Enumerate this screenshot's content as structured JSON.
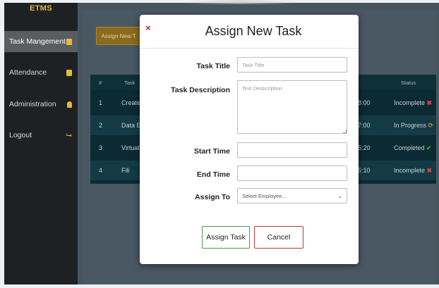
{
  "app": {
    "brand": "ETMS"
  },
  "sidebar": {
    "items": [
      {
        "label": "Task Mangement",
        "icon": "list-icon",
        "active": true
      },
      {
        "label": "Attendance",
        "icon": "list-icon",
        "active": false
      },
      {
        "label": "Administration",
        "icon": "user-icon",
        "active": false
      },
      {
        "label": "Logout",
        "icon": "logout-icon",
        "active": false
      }
    ]
  },
  "main": {
    "assign_button_label": "Assign New T",
    "table": {
      "headers": [
        "#",
        "Task",
        "",
        "Status"
      ],
      "rows": [
        {
          "num": "1",
          "task": "Create",
          "time": "18:00",
          "status": "Incomplete",
          "status_icon": "x-icon"
        },
        {
          "num": "2",
          "task": "Data E",
          "time": "17:00",
          "status": "In Progress",
          "status_icon": "refresh-icon"
        },
        {
          "num": "3",
          "task": "Virtual M",
          "time": "15:20",
          "status": "Completed",
          "status_icon": "check-icon"
        },
        {
          "num": "4",
          "task": "Fili",
          "time": "15:10",
          "status": "Incomplete",
          "status_icon": "x-icon"
        }
      ]
    }
  },
  "modal": {
    "close_glyph": "×",
    "title": "Assign New Task",
    "fields": {
      "task_title": {
        "label": "Task Title",
        "placeholder": "Task Title",
        "value": ""
      },
      "task_description": {
        "label": "Task Description",
        "placeholder": "Text Deskcription",
        "value": ""
      },
      "start_time": {
        "label": "Start Time",
        "value": ""
      },
      "end_time": {
        "label": "End Time",
        "value": ""
      },
      "assign_to": {
        "label": "Assign To",
        "selected": "Select Employee..."
      }
    },
    "buttons": {
      "assign": "Assign Task",
      "cancel": "Cancel"
    }
  },
  "colors": {
    "accent": "#e8b93a",
    "sidebar_bg": "#1e2124",
    "table_bg": "#0c2a33",
    "close_red": "#d01f1f",
    "incomplete": "#d9473f",
    "completed": "#5fbf4a",
    "assign_border": "#4f9a4f",
    "cancel_border": "#b83a3a"
  }
}
